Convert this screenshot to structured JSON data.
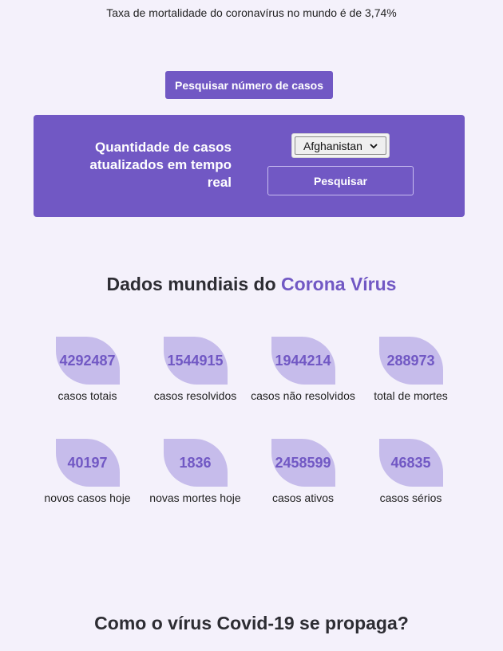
{
  "mortality_text": "Taxa de mortalidade do coronavírus no mundo é de 3,74%",
  "search_cases_button": "Pesquisar número de casos",
  "panel": {
    "label": "Quantidade de casos atualizados em tempo real",
    "selected_country": "Afghanistan",
    "chevron_icon": "chevron-down-icon",
    "search_button": "Pesquisar"
  },
  "world": {
    "title_prefix": "Dados mundiais do ",
    "title_accent": "Corona Vírus"
  },
  "stats": [
    {
      "value": "4292487",
      "label": "casos totais"
    },
    {
      "value": "1544915",
      "label": "casos resolvidos"
    },
    {
      "value": "1944214",
      "label": "casos não resolvidos"
    },
    {
      "value": "288973",
      "label": "total de mortes"
    },
    {
      "value": "40197",
      "label": "novos casos hoje"
    },
    {
      "value": "1836",
      "label": "novas mortes hoje"
    },
    {
      "value": "2458599",
      "label": "casos ativos"
    },
    {
      "value": "46835",
      "label": "casos sérios"
    }
  ],
  "spread_title": "Como o vírus Covid-19 se propaga?",
  "colors": {
    "accent": "#7158c4",
    "blob": "#c6bceb",
    "background": "#f4f1fb"
  }
}
